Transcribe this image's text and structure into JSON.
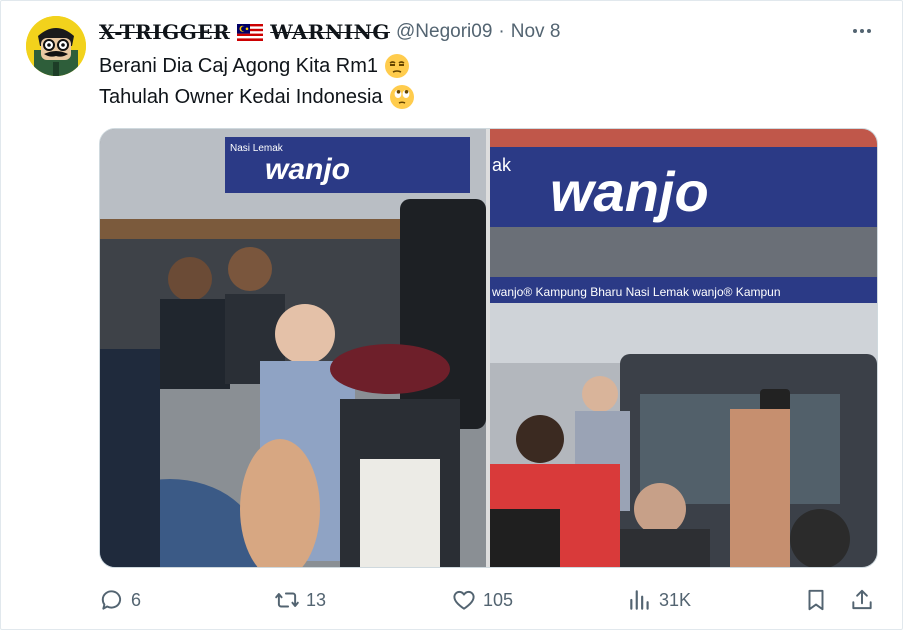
{
  "tweet": {
    "display_name": "X-TRIGGER",
    "display_name_suffix": "WARNING",
    "flag_icon": "malaysia-flag-icon",
    "handle": "@Negori09",
    "separator": "·",
    "date": "Nov 8",
    "text_line_1": "Berani Dia Caj Agong Kita Rm1",
    "text_line_1_emoji": "unamused-face-icon",
    "text_line_2": "Tahulah Owner Kedai Indonesia",
    "text_line_2_emoji": "rolling-eyes-face-icon"
  },
  "media": {
    "left_photo_sign": "wanjo",
    "left_photo_sign_small": "Nasi Lemak",
    "right_photo_sign": "wanjo",
    "right_photo_sign_prefix": "ak",
    "right_photo_banner": "wanjo® Kampung Bharu   Nasi Lemak wanjo® Kampun"
  },
  "actions": {
    "replies": "6",
    "retweets": "13",
    "likes": "105",
    "views": "31K"
  },
  "colors": {
    "text": "#0f1419",
    "secondary": "#536471",
    "border": "#cfd9de",
    "sign_blue": "#2b3a86"
  }
}
